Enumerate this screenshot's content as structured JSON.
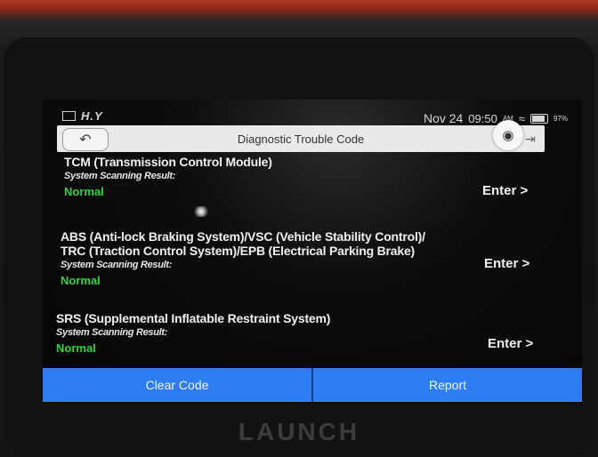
{
  "status_bar": {
    "left_text": "H.Y",
    "date": "Nov 24",
    "time": "09:50",
    "am_pm": "AM",
    "battery": "97%"
  },
  "header": {
    "title": "Diagnostic Trouble Code",
    "back_icon": "back-arrow-icon",
    "camera_icon": "camera-icon",
    "exit_icon": "exit-icon"
  },
  "systems": [
    {
      "name": "TCM (Transmission Control Module)",
      "result_label": "System Scanning Result:",
      "status": "Normal",
      "enter_label": "Enter >"
    },
    {
      "name_line1": "ABS (Anti-lock Braking System)/VSC (Vehicle Stability Control)/",
      "name_line2": "TRC (Traction Control System)/EPB (Electrical Parking Brake)",
      "result_label": "System Scanning Result:",
      "status": "Normal",
      "enter_label": "Enter >"
    },
    {
      "name": "SRS (Supplemental Inflatable Restraint System)",
      "result_label": "System Scanning Result:",
      "status": "Normal",
      "enter_label": "Enter >"
    }
  ],
  "footer": {
    "clear_code_label": "Clear Code",
    "report_label": "Report"
  },
  "brand": "LAUNCH",
  "colors": {
    "status_normal": "#2fd43a",
    "button_blue": "#2d7df3",
    "title_bar": "#e9e9ea"
  }
}
